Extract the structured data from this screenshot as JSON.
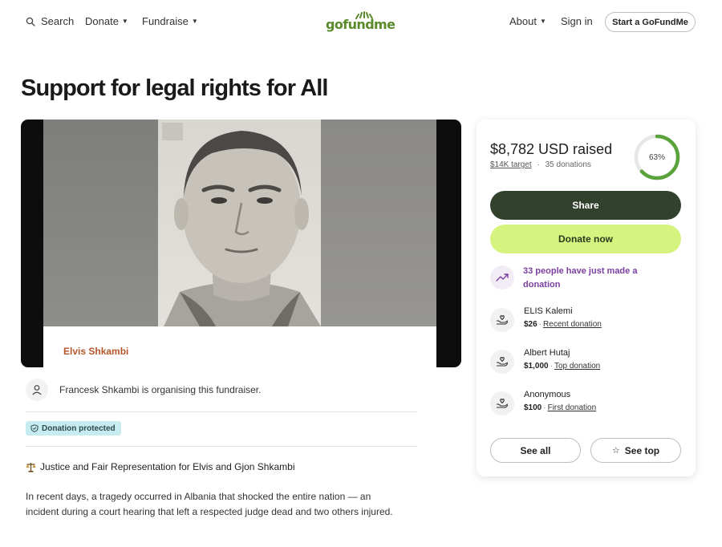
{
  "nav": {
    "search": {
      "label": "Search",
      "icon": "search-icon"
    },
    "donate": {
      "label": "Donate",
      "icon": "caret-down-icon"
    },
    "fundraise": {
      "label": "Fundraise",
      "icon": "caret-down-icon"
    },
    "logo": "gofundme",
    "about": {
      "label": "About",
      "icon": "caret-down-icon"
    },
    "sign_in": "Sign in",
    "start_button": "Start a GoFundMe"
  },
  "campaign": {
    "title": "Support for legal rights for All",
    "image_caption": "Elvis Shkambi",
    "organiser_text": "Francesk Shkambi is organising this fundraiser.",
    "protected_badge": "Donation protected",
    "story_heading": "Justice and Fair Representation for Elvis and Gjon Shkambi",
    "story_body": "In recent days, a tragedy occurred in Albania that shocked the entire nation — an incident during a court hearing that left a respected judge dead and two others injured."
  },
  "donation_card": {
    "raised": "$8,782 USD raised",
    "target": "$14K target",
    "separator": "·",
    "donations": "35 donations",
    "progress_percent": 63,
    "progress_label": "63%",
    "share_label": "Share",
    "donate_label": "Donate now",
    "trend_text": "33 people have just made a donation",
    "donors": [
      {
        "name": "ELIS Kalemi",
        "amount": "$26",
        "separator": "·",
        "kind": "Recent donation"
      },
      {
        "name": "Albert Hutaj",
        "amount": "$1,000",
        "separator": "·",
        "kind": "Top donation"
      },
      {
        "name": "Anonymous",
        "amount": "$100",
        "separator": "·",
        "kind": "First donation"
      }
    ],
    "see_all_label": "See all",
    "see_top_label": "See top"
  },
  "colors": {
    "brand_green": "#5a8a2a",
    "share_button": "#31412c",
    "donate_button": "#d6f27f",
    "progress_ring": "#5aa33c",
    "trend_purple": "#7a3fa0",
    "protected_badge": "#c6ecef",
    "caption_orange": "#b4562b"
  }
}
